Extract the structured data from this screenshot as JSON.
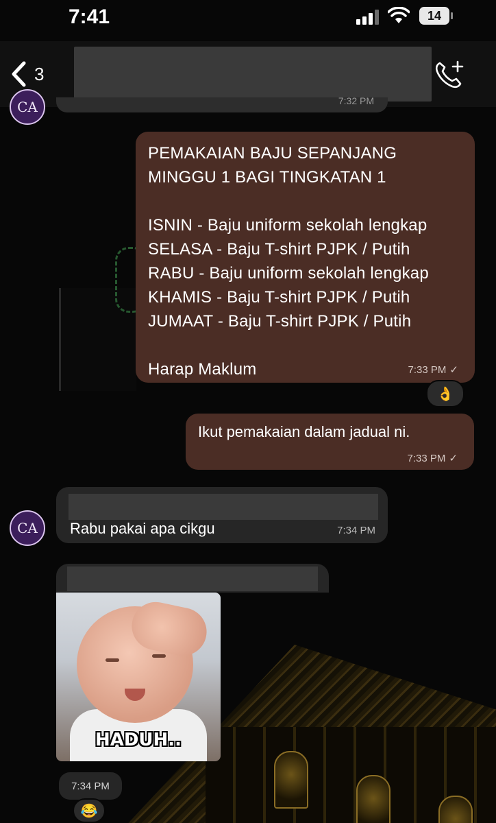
{
  "status_bar": {
    "time": "7:41",
    "battery": "14"
  },
  "header": {
    "back_count": "3"
  },
  "remnant_time": "7:32 PM",
  "messages": [
    {
      "lines": [
        "PEMAKAIAN BAJU SEPANJANG",
        "MINGGU 1 BAGI TINGKATAN 1",
        "",
        "ISNIN - Baju uniform sekolah lengkap",
        "SELASA - Baju T-shirt PJPK / Putih",
        "RABU - Baju uniform sekolah lengkap",
        "KHAMIS - Baju T-shirt PJPK / Putih",
        "JUMAAT - Baju T-shirt PJPK / Putih",
        "",
        "Harap Maklum"
      ],
      "time": "7:33 PM",
      "status": "✓",
      "reaction": "👌"
    },
    {
      "text": "Ikut pemakaian dalam jadual ni.",
      "time": "7:33 PM",
      "status": "✓"
    },
    {
      "text": "Rabu pakai apa cikgu",
      "time": "7:34 PM"
    },
    {
      "sticker_caption": "HADUH..",
      "time": "7:34 PM",
      "reaction": "😂"
    }
  ],
  "avatar_text": "CA",
  "colors": {
    "outgoing_bubble": "#4b2d25",
    "incoming_bubble": "#262626",
    "background": "#070707"
  }
}
